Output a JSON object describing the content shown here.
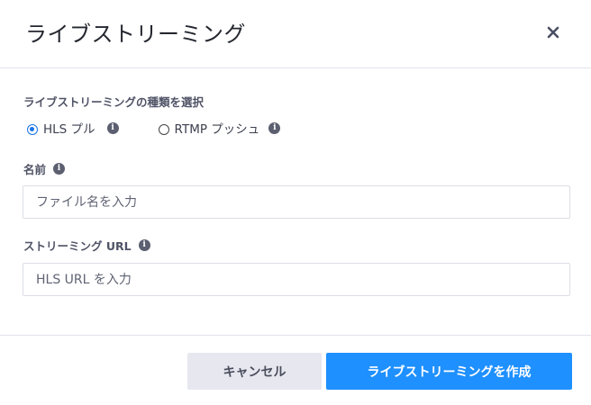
{
  "dialog": {
    "title": "ライブストリーミング",
    "close_label": "×"
  },
  "stream_type": {
    "label": "ライブストリーミングの種類を選択",
    "options": [
      {
        "label": "HLS プル",
        "selected": true
      },
      {
        "label": "RTMP プッシュ",
        "selected": false
      }
    ]
  },
  "name_field": {
    "label": "名前",
    "placeholder": "ファイル名を入力",
    "value": ""
  },
  "url_field": {
    "label": "ストリーミング URL",
    "placeholder": "HLS URL を入力",
    "value": ""
  },
  "footer": {
    "cancel_label": "キャンセル",
    "create_label": "ライブストリーミングを作成"
  },
  "info_icon_glyph": "i",
  "colors": {
    "primary": "#1e90ff",
    "cancel_bg": "#e6e7ef",
    "radio_selected": "#1a73e8"
  }
}
